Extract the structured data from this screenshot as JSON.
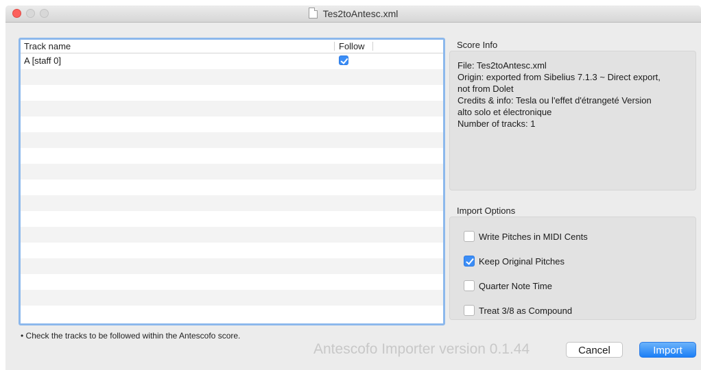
{
  "window": {
    "title": "Tes2toAntesc.xml"
  },
  "table": {
    "headers": {
      "track_name": "Track name",
      "follow": "Follow"
    },
    "rows": [
      {
        "name": "A [staff 0]",
        "follow": true
      }
    ],
    "empty_row_count": 16
  },
  "footnote": "• Check the tracks to be followed within the Antescofo score.",
  "version": "Antescofo Importer version 0.1.44",
  "score_info": {
    "label": "Score Info",
    "lines": [
      "File: Tes2toAntesc.xml",
      "Origin: exported from Sibelius 7.1.3 ~ Direct export,",
      "not from Dolet",
      "Credits & info: Tesla ou l'effet d'étrangeté Version",
      "alto solo et électronique",
      "Number of tracks: 1"
    ]
  },
  "import_options": {
    "label": "Import Options",
    "items": [
      {
        "label": "Write Pitches in MIDI Cents",
        "checked": false
      },
      {
        "label": "Keep Original Pitches",
        "checked": true
      },
      {
        "label": "Quarter Note Time",
        "checked": false
      },
      {
        "label": "Treat 3/8 as Compound",
        "checked": false
      }
    ]
  },
  "buttons": {
    "cancel": "Cancel",
    "import": "Import"
  },
  "colors": {
    "accent": "#3b8df6",
    "close_light": "#fc605c",
    "table_focus": "#8cb8ec"
  }
}
